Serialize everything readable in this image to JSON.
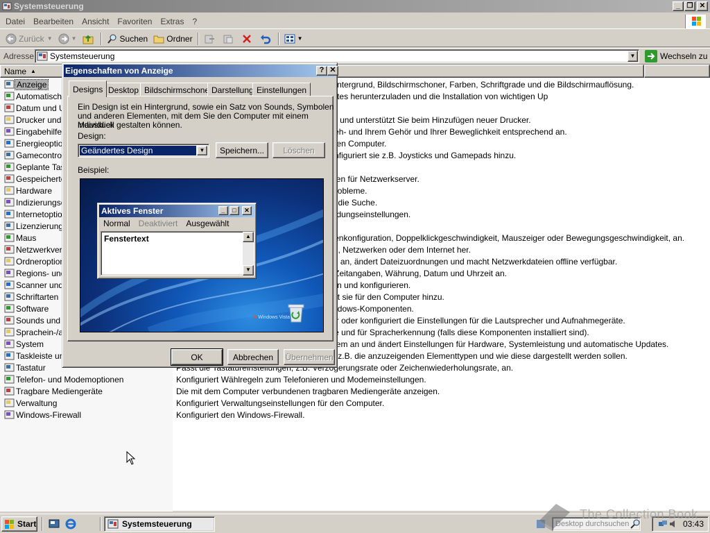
{
  "window": {
    "title": "Systemsteuerung",
    "menu": [
      "Datei",
      "Bearbeiten",
      "Ansicht",
      "Favoriten",
      "Extras",
      "?"
    ],
    "toolbar": {
      "back": "Zurück",
      "search": "Suchen",
      "folders": "Ordner"
    },
    "address": {
      "label": "Adresse",
      "value": "Systemsteuerung",
      "go": "Wechseln zu"
    },
    "columns": {
      "name": "Name"
    }
  },
  "items": [
    {
      "name": "Anzeige",
      "desc": "Ändert das Aussehen des Desktops, z.B. Hintergrund, Bildschirmschoner, Farben, Schriftgrade und die Bildschirmauflösung.",
      "selected": true
    },
    {
      "name": "Automatische Updates",
      "desc": "Richtet Windows ein, um automatisch Updates herunterzuladen und die Installation von wichtigen Up"
    },
    {
      "name": "Datum und Uhrzeit",
      "desc": ""
    },
    {
      "name": "Drucker und Faxgeräte",
      "desc": "Zeigt installierte Drucker und Faxdrucker an und unterstützt Sie beim Hinzufügen neuer Drucker."
    },
    {
      "name": "Eingabehilfen",
      "desc": "Passt die Computereinstellungen an Ihre Seh- und Ihrem Gehör und Ihrer Beweglichkeit entsprechend an."
    },
    {
      "name": "Energieoptionen",
      "desc": "Konfiguriert die Energiesparfunktionen für den Computer."
    },
    {
      "name": "Gamecontroller",
      "desc": "Fügt Gamecontroller hinzu, entfernt und konfiguriert sie z.B. Joysticks und Gamepads hinzu."
    },
    {
      "name": "Geplante Tasks",
      "desc": ""
    },
    {
      "name": "Gespeicherte Benutzernamen und Kennwörter",
      "desc": "Verwaltet gespeicherte Anmeldeinformationen für Netzwerkserver."
    },
    {
      "name": "Hardware",
      "desc": "Installiert Hardware und behebt Hardwareprobleme."
    },
    {
      "name": "Indizierungsoptionen",
      "desc": "Ändert die Einstellungen der Indizierung für die Suche."
    },
    {
      "name": "Internetoptionen",
      "desc": "Konfiguriert die Internetanzeige- und Verbindungseinstellungen."
    },
    {
      "name": "Lizenzierung",
      "desc": ""
    },
    {
      "name": "Maus",
      "desc": "Ändert Mauseinstellungen, z.B. Schaltflächenkonfiguration, Doppelklickgeschwindigkeit, Mauszeiger oder Bewegungsgeschwindigkeit, an."
    },
    {
      "name": "Netzwerkverbindungen",
      "desc": "Stellt Verbindungen mit anderen Computern, Netzwerken oder dem Internet her."
    },
    {
      "name": "Ordneroptionen",
      "desc": "Passt die Anzeige von Dateien und Ordnern an, ändert Dateizuordnungen und macht Netzwerkdateien offline verfügbar."
    },
    {
      "name": "Regions- und Sprachoptionen",
      "desc": "Ändert die Anzeige von Sprachen, Zahlen, Zeitangaben, Währung, Datum und Uhrzeit an."
    },
    {
      "name": "Scanner und Kameras",
      "desc": "Scanner und Kameras hinzufügen, entfernen und konfigurieren."
    },
    {
      "name": "Schriftarten",
      "desc": "Fügt Schriftarten hinzu, ändert und verwaltet sie für den Computer hinzu."
    },
    {
      "name": "Software",
      "desc": "Installiert oder entfernt Programme und Windows-Komponenten."
    },
    {
      "name": "Sounds und Audiogeräte",
      "desc": "Ändert das Soundschema für den Computer oder konfiguriert die Einstellungen für die Lautsprecher und Aufnahmegeräte."
    },
    {
      "name": "Sprachein-/ausgabe",
      "desc": "Ändert Einstellungen für die Sprachausgabe und für Spracherkennung (falls diese Komponenten installiert sind)."
    },
    {
      "name": "System",
      "desc": "Zeigt Informationen über das Computersystem an und ändert Einstellungen für Hardware, Systemleistung und automatische Updates."
    },
    {
      "name": "Taskleiste und Startmenü",
      "desc": "Passt das Startmenü und die Taskleiste an, z.B. die anzuzeigenden Elementtypen und wie diese dargestellt werden sollen."
    },
    {
      "name": "Tastatur",
      "desc": "Passt die Tastatureinstellungen, z.B. Verzögerungsrate oder Zeichenwiederholungsrate, an."
    },
    {
      "name": "Telefon- und Modemoptionen",
      "desc": "Konfiguriert Wählregeln zum Telefonieren und Modemeinstellungen."
    },
    {
      "name": "Tragbare Mediengeräte",
      "desc": "Die mit dem Computer verbundenen tragbaren Mediengeräte anzeigen."
    },
    {
      "name": "Verwaltung",
      "desc": "Konfiguriert Verwaltungseinstellungen für den Computer."
    },
    {
      "name": "Windows-Firewall",
      "desc": "Konfiguriert den Windows-Firewall."
    }
  ],
  "dialog": {
    "title": "Eigenschaften von Anzeige",
    "help": "?",
    "close": "X",
    "tabs": [
      "Designs",
      "Desktop",
      "Bildschirmschoner",
      "Darstellung",
      "Einstellungen"
    ],
    "active_tab": "Designs",
    "intro": [
      "Ein Design ist ein Hintergrund, sowie ein Satz von Sounds, Symbolen",
      "und anderen Elementen, mit dem Sie den Computer mit einem Mausklick",
      "individuell gestalten können."
    ],
    "design_label": "Design:",
    "design_value": "Geändertes Design",
    "save_button": "Speichern...",
    "delete_button": "Löschen",
    "sample_label": "Beispiel:",
    "preview": {
      "window_title": "Aktives Fenster",
      "menu_normal": "Normal",
      "menu_disabled": "Deaktiviert",
      "menu_selected": "Ausgewählt",
      "window_text": "Fenstertext",
      "logo_text": "Windows Vista"
    },
    "ok": "OK",
    "cancel": "Abbrechen",
    "apply": "Übernehmen"
  },
  "taskbar": {
    "start": "Start",
    "task": "Systemsteuerung",
    "search_placeholder": "Desktop durchsuchen",
    "clock": "03:43"
  },
  "watermark": "The Collection Book"
}
